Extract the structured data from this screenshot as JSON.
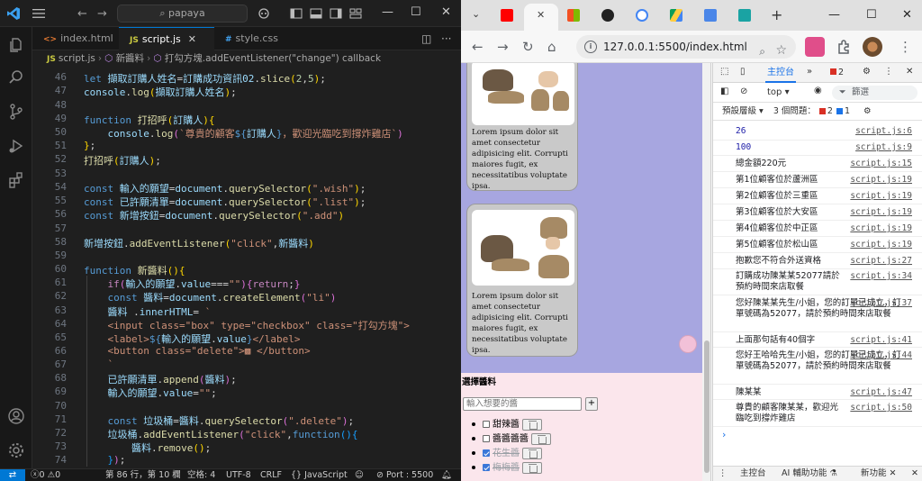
{
  "vscode": {
    "search": "papaya",
    "tabs": [
      {
        "icon": "<>",
        "label": "index.html"
      },
      {
        "icon": "JS",
        "label": "script.js"
      },
      {
        "icon": "#",
        "label": "style.css"
      }
    ],
    "breadcrumb": [
      "script.js",
      "新醬料",
      "打勾方塊.addEventListener(\"change\") callback"
    ],
    "gutter": [
      "46",
      "47",
      "48",
      "49",
      "50",
      "51",
      "52",
      "53",
      "54",
      "55",
      "56",
      "57",
      "58",
      "59",
      "60",
      "61",
      "62",
      "63",
      "64",
      "65",
      "66",
      "67",
      "68",
      "69",
      "70",
      "71",
      "72",
      "73",
      "74"
    ],
    "status": {
      "errors": "0",
      "warnings": "0",
      "position": "第 86 行，第 10 欄",
      "spaces": "空格: 4",
      "encoding": "UTF-8",
      "eol": "CRLF",
      "language": "JavaScript",
      "port": "Port : 5500"
    },
    "accent": "#0078d4"
  },
  "chrome": {
    "url": "127.0.0.1:5500/index.html",
    "tab_colors": [
      "#ff0000",
      "#f25022",
      "#222222",
      "#4285f4",
      "#0f9d58",
      "#4a86e8",
      "#1aa3a3"
    ],
    "page": {
      "card_text": "Lorem ipsum dolor sit amet consectetur adipisicing elit. Corrupti maiores fugit, ex necessitatibus voluptate ipsa.",
      "form_title": "選擇醬料",
      "input_placeholder": "輸入想要的醬",
      "add_label": "+",
      "items": [
        {
          "label": "甜辣醬",
          "checked": false
        },
        {
          "label": "醬醬醬醬",
          "checked": false
        },
        {
          "label": "花生醬",
          "checked": true
        },
        {
          "label": "梅梅醬",
          "checked": true
        }
      ]
    },
    "devtools": {
      "tab_console": "主控台",
      "error_badge": "2",
      "top_select": "top",
      "filter": "篩選",
      "levels": "預設層級",
      "issues": "3 個問題：",
      "issue_errors": "2",
      "issue_info": "1",
      "logs": [
        {
          "msg": "26",
          "src": "script.js:6",
          "blue": true
        },
        {
          "msg": "100",
          "src": "script.js:9",
          "blue": true
        },
        {
          "msg": "總金額220元",
          "src": "script.js:15"
        },
        {
          "msg": "第1位顧客位於蘆洲區",
          "src": "script.js:19"
        },
        {
          "msg": "第2位顧客位於三重區",
          "src": "script.js:19"
        },
        {
          "msg": "第3位顧客位於大安區",
          "src": "script.js:19"
        },
        {
          "msg": "第4位顧客位於中正區",
          "src": "script.js:19"
        },
        {
          "msg": "第5位顧客位於松山區",
          "src": "script.js:19"
        },
        {
          "msg": "抱歉您不符合外送資格",
          "src": "script.js:27"
        },
        {
          "msg": "訂購成功陳某某52077請於預約時間來店取餐",
          "src": "script.js:34"
        },
        {
          "msg": "您好陳某某先生/小姐，您的訂單已成立，訂單號碼為52077，請於預約時間來店取餐",
          "src": "script.js:37"
        },
        {
          "msg": "上面那句話有40個字",
          "src": "script.js:41"
        },
        {
          "msg": "您好王哈哈先生/小姐，您的訂單已成立，訂單號碼為52077，請於預約時間來店取餐",
          "src": "script.js:44"
        },
        {
          "msg": "陳某某",
          "src": "script.js:47"
        },
        {
          "msg": "尊貴的顧客陳某某，歡迎光臨吃到撐炸雞店",
          "src": "script.js:50"
        }
      ],
      "drawer_console": "主控台",
      "drawer_ai": "AI 輔助功能",
      "drawer_new": "新功能"
    }
  }
}
